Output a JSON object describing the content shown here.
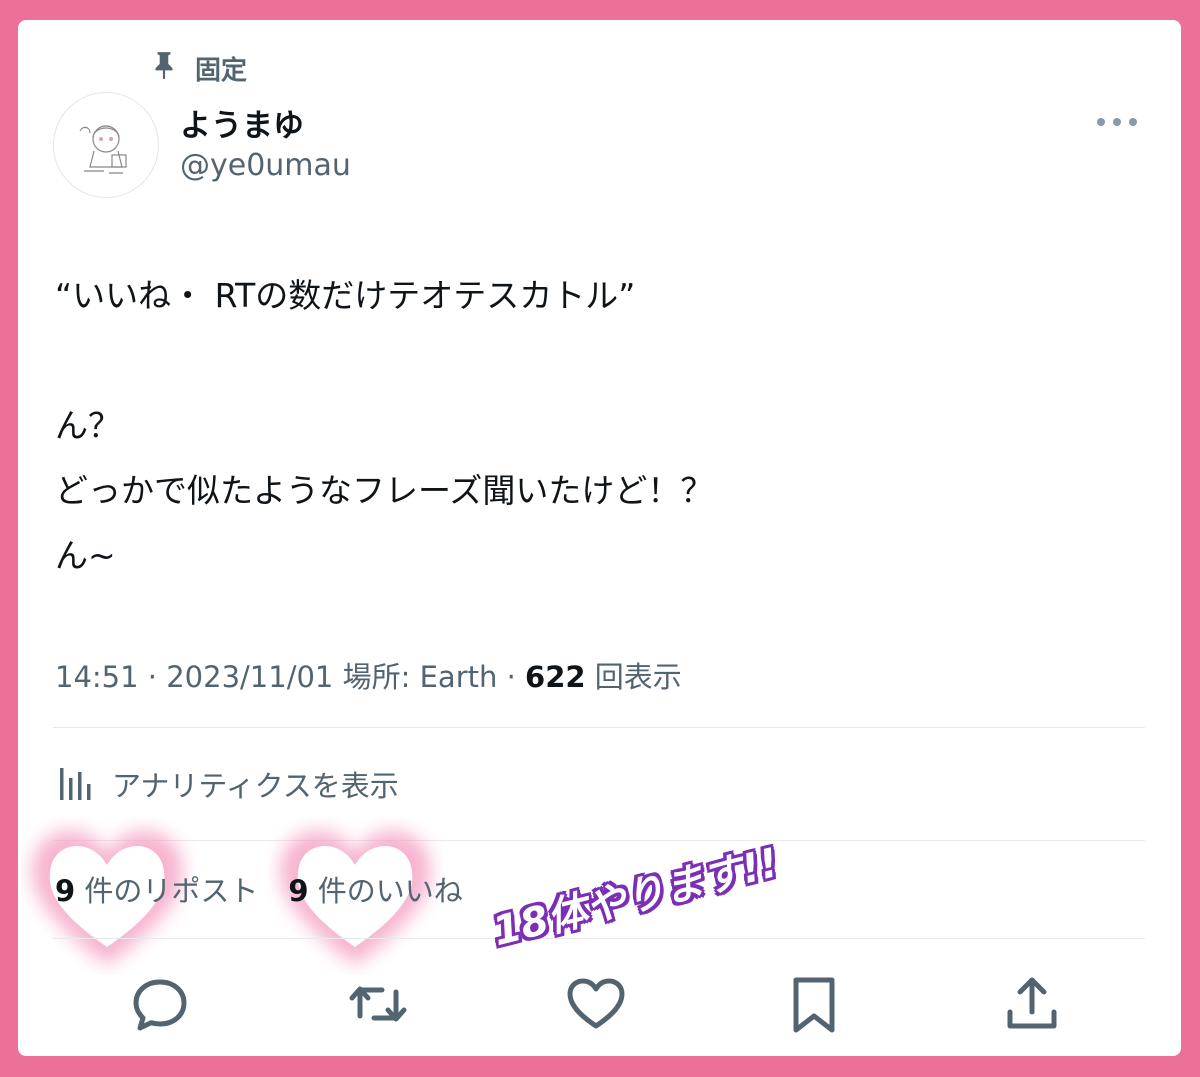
{
  "pinned": {
    "label": "固定"
  },
  "author": {
    "name": "ようまゆ",
    "handle": "@ye0umau"
  },
  "tweet": {
    "lines": [
      "“いいね・ RTの数だけテオテスカトル”",
      "",
      "ん？",
      "どっかで似たようなフレーズ聞いたけど！？",
      "ん~"
    ]
  },
  "meta": {
    "time": "14:51",
    "sep1": " · ",
    "date": "2023/11/01",
    "location": " 場所: Earth",
    "sep2": " · ",
    "views_count": "622",
    "views_label": " 回表示"
  },
  "analytics": {
    "label": "アナリティクスを表示"
  },
  "stats": {
    "reposts_count": "9",
    "reposts_label": " 件のリポスト",
    "likes_count": "9",
    "likes_label": " 件のいいね"
  },
  "sticker": {
    "text": "18体やります!!"
  },
  "colors": {
    "frame": "#ec7097",
    "sticker_outline": "#7a2fb5",
    "secondary_text": "#536471"
  },
  "icons": [
    "pin-icon",
    "more-icon",
    "analytics-icon",
    "reply-icon",
    "repost-icon",
    "like-icon",
    "bookmark-icon",
    "share-icon"
  ]
}
